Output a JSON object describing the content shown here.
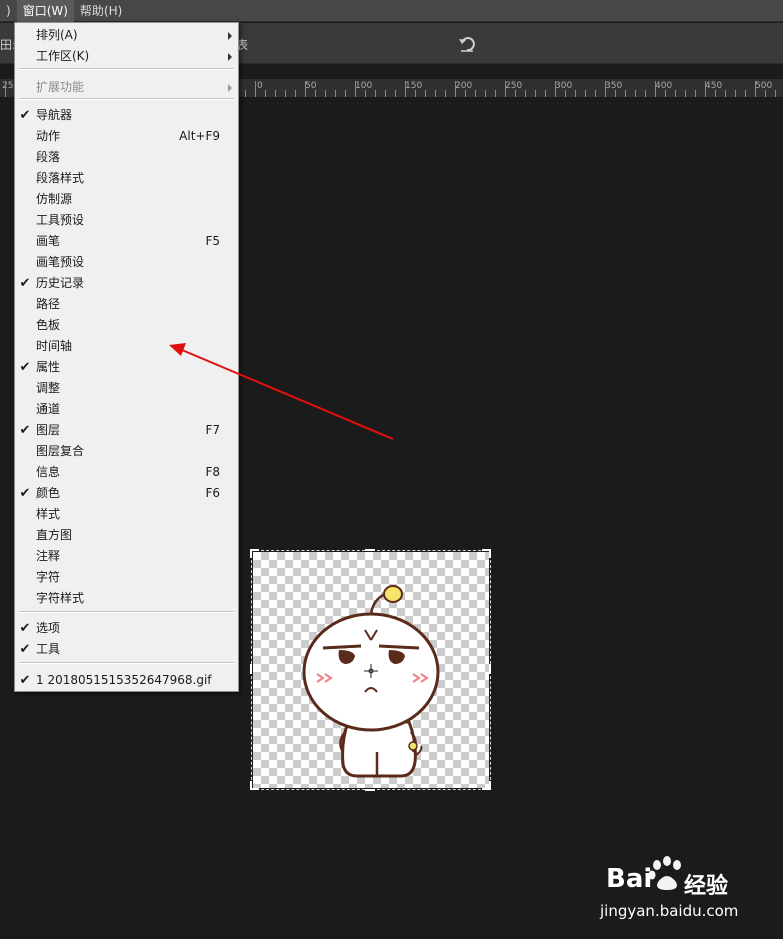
{
  "menubar": {
    "items": [
      {
        "label": ")"
      },
      {
        "label": "窗口(W)"
      },
      {
        "label": "帮助(H)"
      }
    ]
  },
  "options_bar": {
    "left_label": "田:",
    "right_fragment": "表"
  },
  "ruler": {
    "labels": [
      "25",
      "0",
      "50",
      "100",
      "150",
      "200",
      "250",
      "300",
      "350",
      "400",
      "450",
      "500"
    ]
  },
  "window_menu": {
    "items": [
      {
        "label": "排列(A)",
        "checked": false,
        "shortcut": "",
        "submenu": true,
        "disabled": false
      },
      {
        "label": "工作区(K)",
        "checked": false,
        "shortcut": "",
        "submenu": true,
        "disabled": false
      },
      {
        "label": "扩展功能",
        "checked": false,
        "shortcut": "",
        "submenu": true,
        "disabled": true
      },
      {
        "label": "导航器",
        "checked": true,
        "shortcut": "",
        "submenu": false,
        "disabled": false
      },
      {
        "label": "动作",
        "checked": false,
        "shortcut": "Alt+F9",
        "submenu": false,
        "disabled": false
      },
      {
        "label": "段落",
        "checked": false,
        "shortcut": "",
        "submenu": false,
        "disabled": false
      },
      {
        "label": "段落样式",
        "checked": false,
        "shortcut": "",
        "submenu": false,
        "disabled": false
      },
      {
        "label": "仿制源",
        "checked": false,
        "shortcut": "",
        "submenu": false,
        "disabled": false
      },
      {
        "label": "工具预设",
        "checked": false,
        "shortcut": "",
        "submenu": false,
        "disabled": false
      },
      {
        "label": "画笔",
        "checked": false,
        "shortcut": "F5",
        "submenu": false,
        "disabled": false
      },
      {
        "label": "画笔预设",
        "checked": false,
        "shortcut": "",
        "submenu": false,
        "disabled": false
      },
      {
        "label": "历史记录",
        "checked": true,
        "shortcut": "",
        "submenu": false,
        "disabled": false
      },
      {
        "label": "路径",
        "checked": false,
        "shortcut": "",
        "submenu": false,
        "disabled": false
      },
      {
        "label": "色板",
        "checked": false,
        "shortcut": "",
        "submenu": false,
        "disabled": false
      },
      {
        "label": "时间轴",
        "checked": false,
        "shortcut": "",
        "submenu": false,
        "disabled": false
      },
      {
        "label": "属性",
        "checked": true,
        "shortcut": "",
        "submenu": false,
        "disabled": false
      },
      {
        "label": "调整",
        "checked": false,
        "shortcut": "",
        "submenu": false,
        "disabled": false
      },
      {
        "label": "通道",
        "checked": false,
        "shortcut": "",
        "submenu": false,
        "disabled": false
      },
      {
        "label": "图层",
        "checked": true,
        "shortcut": "F7",
        "submenu": false,
        "disabled": false
      },
      {
        "label": "图层复合",
        "checked": false,
        "shortcut": "",
        "submenu": false,
        "disabled": false
      },
      {
        "label": "信息",
        "checked": false,
        "shortcut": "F8",
        "submenu": false,
        "disabled": false
      },
      {
        "label": "颜色",
        "checked": true,
        "shortcut": "F6",
        "submenu": false,
        "disabled": false
      },
      {
        "label": "样式",
        "checked": false,
        "shortcut": "",
        "submenu": false,
        "disabled": false
      },
      {
        "label": "直方图",
        "checked": false,
        "shortcut": "",
        "submenu": false,
        "disabled": false
      },
      {
        "label": "注释",
        "checked": false,
        "shortcut": "",
        "submenu": false,
        "disabled": false
      },
      {
        "label": "字符",
        "checked": false,
        "shortcut": "",
        "submenu": false,
        "disabled": false
      },
      {
        "label": "字符样式",
        "checked": false,
        "shortcut": "",
        "submenu": false,
        "disabled": false
      },
      {
        "label": "选项",
        "checked": true,
        "shortcut": "",
        "submenu": false,
        "disabled": false
      },
      {
        "label": "工具",
        "checked": true,
        "shortcut": "",
        "submenu": false,
        "disabled": false
      },
      {
        "label": "1 2018051515352647968.gif",
        "checked": true,
        "shortcut": "",
        "submenu": false,
        "disabled": false
      }
    ],
    "check_glyph": "✔"
  },
  "watermark": {
    "brand": "Bai",
    "brand_cn": "经验",
    "url": "jingyan.baidu.com"
  },
  "colors": {
    "annotation_arrow": "#e01010",
    "menu_background": "#f0f0f0",
    "app_background": "#1b1b1b"
  }
}
